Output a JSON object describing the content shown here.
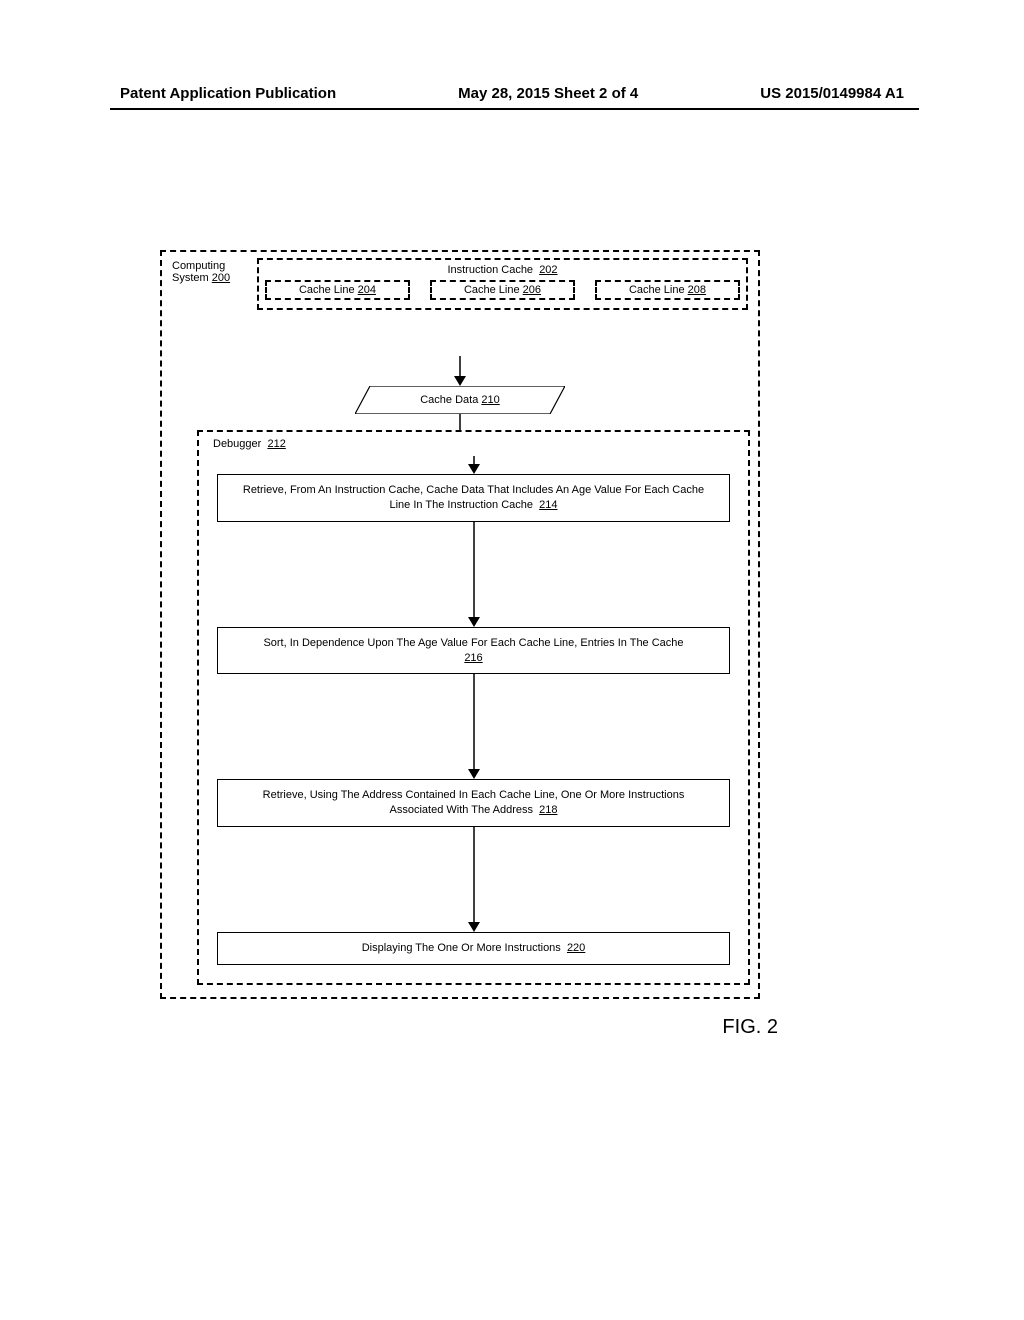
{
  "header": {
    "left": "Patent Application Publication",
    "center": "May 28, 2015  Sheet 2 of 4",
    "right": "US 2015/0149984 A1"
  },
  "computing_system": {
    "label_line1": "Computing",
    "label_line2": "System",
    "ref": "200"
  },
  "instruction_cache": {
    "title": "Instruction Cache",
    "ref": "202",
    "lines": [
      {
        "label": "Cache Line",
        "ref": "204"
      },
      {
        "label": "Cache Line",
        "ref": "206"
      },
      {
        "label": "Cache Line",
        "ref": "208"
      }
    ]
  },
  "cache_data": {
    "label": "Cache Data",
    "ref": "210"
  },
  "debugger": {
    "label": "Debugger",
    "ref": "212"
  },
  "steps": [
    {
      "text": "Retrieve, From An Instruction Cache, Cache Data That Includes An Age Value For Each Cache Line In The Instruction Cache",
      "ref": "214"
    },
    {
      "text": "Sort, In Dependence Upon The Age Value For Each Cache Line, Entries In The Cache",
      "ref": "216"
    },
    {
      "text": "Retrieve, Using The Address Contained In Each Cache Line, One Or More Instructions Associated With The Address",
      "ref": "218"
    },
    {
      "text": "Displaying The One Or More Instructions",
      "ref": "220"
    }
  ],
  "figure_label": "FIG. 2"
}
